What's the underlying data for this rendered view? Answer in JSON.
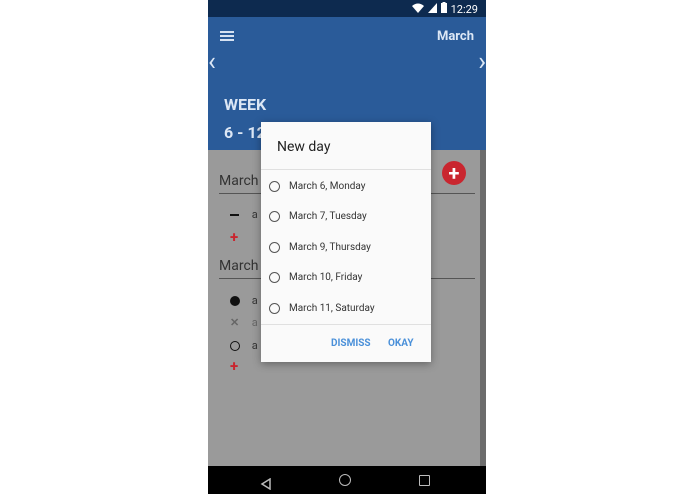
{
  "status": {
    "time": "12:29"
  },
  "appbar": {
    "month": "March",
    "week_label": "WEEK",
    "week_range": "6 - 12"
  },
  "days": [
    {
      "header": "March",
      "items": [
        {
          "marker": "dash",
          "text": "a"
        }
      ]
    },
    {
      "header": "March",
      "items": [
        {
          "marker": "filled",
          "text": "a"
        },
        {
          "marker": "cross",
          "text": "a"
        },
        {
          "marker": "empty",
          "text": "a"
        }
      ]
    }
  ],
  "dialog": {
    "title": "New day",
    "options": [
      "March 6, Monday",
      "March 7, Tuesday",
      "March 9, Thursday",
      "March 10, Friday",
      "March 11, Saturday"
    ],
    "dismiss_label": "DISMISS",
    "okay_label": "OKAY"
  },
  "colors": {
    "appbar": "#2a5b99",
    "accent": "#c9262f",
    "button": "#4a90d9"
  }
}
